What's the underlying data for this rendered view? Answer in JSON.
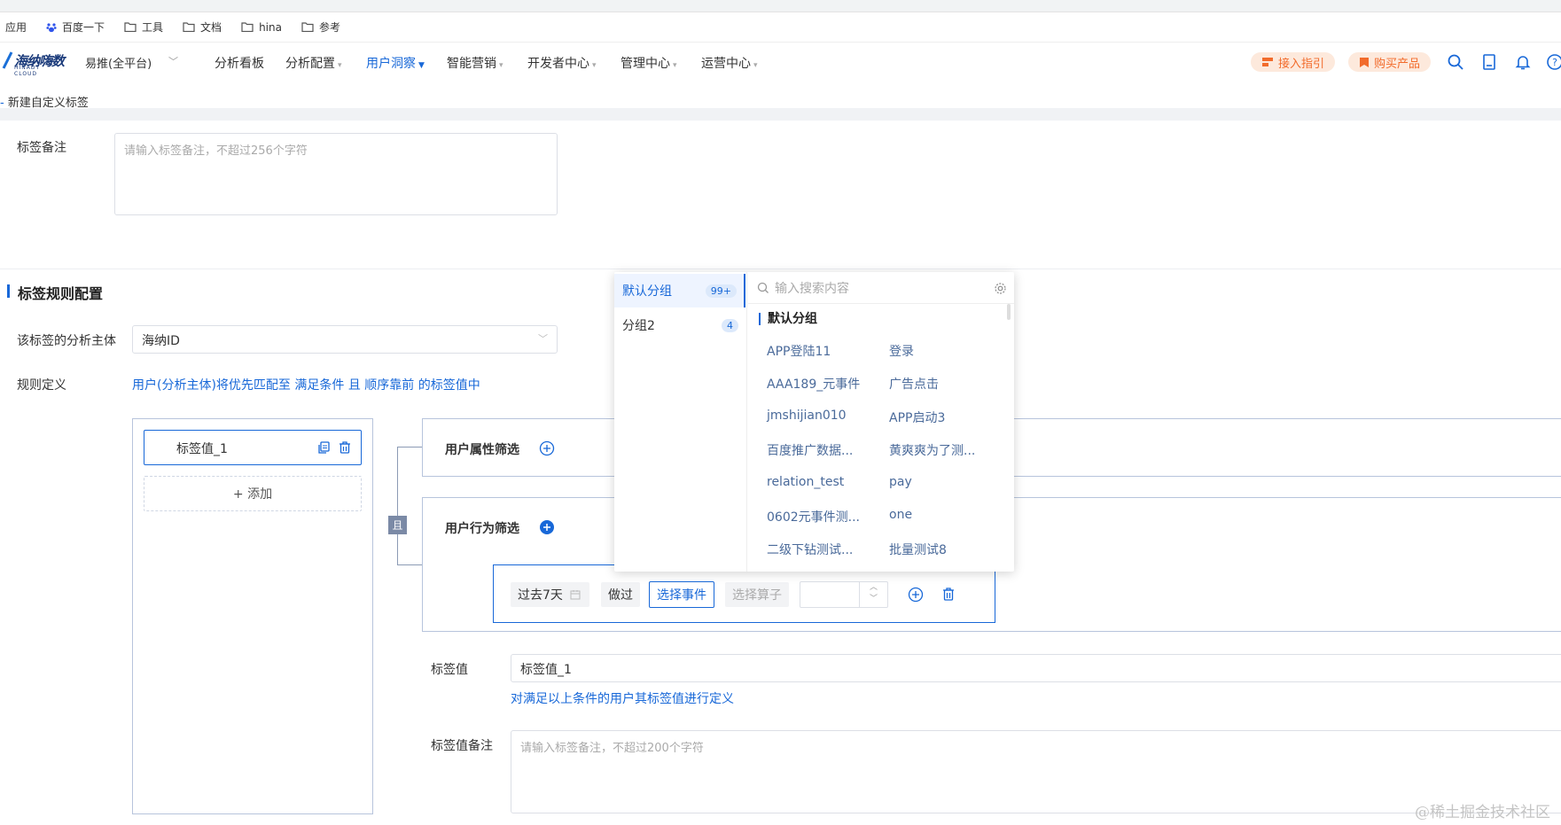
{
  "bookmarks": [
    "应用",
    "百度一下",
    "工具",
    "文档",
    "hina",
    "参考"
  ],
  "header": {
    "logo_text": "海纳嗨数",
    "logo_sub": "HINADT CLOUD",
    "platform": "易推(全平台)",
    "nav": [
      "分析看板",
      "分析配置",
      "用户洞察",
      "智能营销",
      "开发者中心",
      "管理中心",
      "运营中心"
    ],
    "guide": "接入指引",
    "buy": "购买产品"
  },
  "breadcrumb": "新建自定义标签",
  "form": {
    "remark_label": "标签备注",
    "remark_placeholder": "请输入标签备注，不超过256个字符",
    "section_title": "标签规则配置",
    "subject_label": "该标签的分析主体",
    "subject_value": "海纳ID",
    "rule_label": "规则定义",
    "rule_desc": "用户(分析主体)将优先匹配至 满足条件 且 顺序靠前 的标签值中",
    "tag_item": "标签值_1",
    "add_btn": "+ 添加",
    "and_tag": "且",
    "user_attr_filter": "用户属性筛选",
    "user_behavior_filter": "用户行为筛选",
    "time_range": "过去7天",
    "did": "做过",
    "select_event": "选择事件",
    "select_operator": "选择算子",
    "tag_value_label": "标签值",
    "tag_value": "标签值_1",
    "tag_value_hint": "对满足以上条件的用户其标签值进行定义",
    "tag_value_remark_label": "标签值备注",
    "tag_value_remark_placeholder": "请输入标签备注，不超过200个字符"
  },
  "dropdown": {
    "groups": [
      {
        "name": "默认分组",
        "count": "99+"
      },
      {
        "name": "分组2",
        "count": "4"
      }
    ],
    "search_placeholder": "输入搜索内容",
    "section": "默认分组",
    "events": [
      [
        "APP登陆11",
        "登录"
      ],
      [
        "AAA189_元事件",
        "广告点击"
      ],
      [
        "jmshijian010",
        "APP启动3"
      ],
      [
        "百度推广数据...",
        "黄爽爽为了测..."
      ],
      [
        "relation_test",
        "pay"
      ],
      [
        "0602元事件测...",
        "one"
      ],
      [
        "二级下钻测试...",
        "批量测试8"
      ]
    ]
  },
  "watermark": "@稀土掘金技术社区"
}
